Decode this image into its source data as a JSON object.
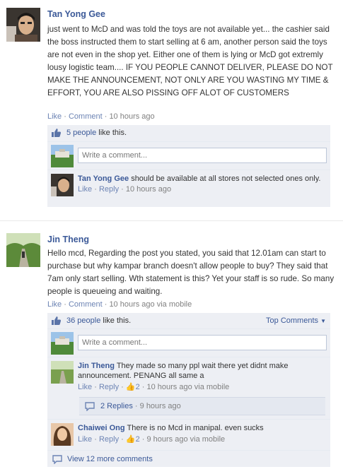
{
  "post1": {
    "author": "Tan Yong Gee",
    "message": "just went to McD and was told the toys are not available yet... the cashier said the boss instructed them to start selling at 6 am, another person said the toys are not even in the shop yet. Either one of them is lying or McD got extremly lousy logistic team.... IF YOU PEOPLE CANNOT DELIVER, PLEASE DO NOT MAKE THE ANNOUNCEMENT, NOT ONLY ARE YOU WASTING MY TIME & EFFORT, YOU ARE ALSO PISSING OFF ALOT OF CUSTOMERS",
    "like_label": "Like",
    "comment_label": "Comment",
    "time": "10 hours ago",
    "likes_count": "5 people",
    "likes_suffix": "like this.",
    "comment_placeholder": "Write a comment...",
    "comments": [
      {
        "author": "Tan Yong Gee",
        "text": "should be available at all stores not selected ones only.",
        "like_label": "Like",
        "reply_label": "Reply",
        "time": "10 hours ago"
      }
    ]
  },
  "post2": {
    "author": "Jin Theng",
    "message": "Hello mcd, Regarding the post you stated, you said that 12.01am can start to purchase but why kampar branch doesn't allow people to buy? They said that 7am only start selling. Wth statement is this? Yet your staff is so rude. So many people is queueing and waiting.",
    "like_label": "Like",
    "comment_label": "Comment",
    "time": "10 hours ago via mobile",
    "likes_count": "36 people",
    "likes_suffix": "like this.",
    "top_comments_label": "Top Comments",
    "comment_placeholder": "Write a comment...",
    "comments": [
      {
        "author": "Jin Theng",
        "text": "They made so many ppl wait there yet didnt make announcement. PENANG all same a",
        "like_label": "Like",
        "reply_label": "Reply",
        "like_count": "2",
        "time": "10 hours ago via mobile",
        "replies_label": "2 Replies",
        "replies_time": "9 hours ago"
      },
      {
        "author": "Chaiwei Ong",
        "text": "There is no Mcd in manipal. even sucks",
        "like_label": "Like",
        "reply_label": "Reply",
        "like_count": "2",
        "time": "9 hours ago via mobile"
      }
    ],
    "view_more_label": "View 12 more comments"
  },
  "colors": {
    "link": "#3b5998",
    "ufi_background": "#edeff4",
    "meta_text": "#808080"
  },
  "icons": {
    "like": "thumbs-up-icon",
    "comment": "speech-bubble-icon",
    "dropdown": "chevron-down-icon"
  }
}
